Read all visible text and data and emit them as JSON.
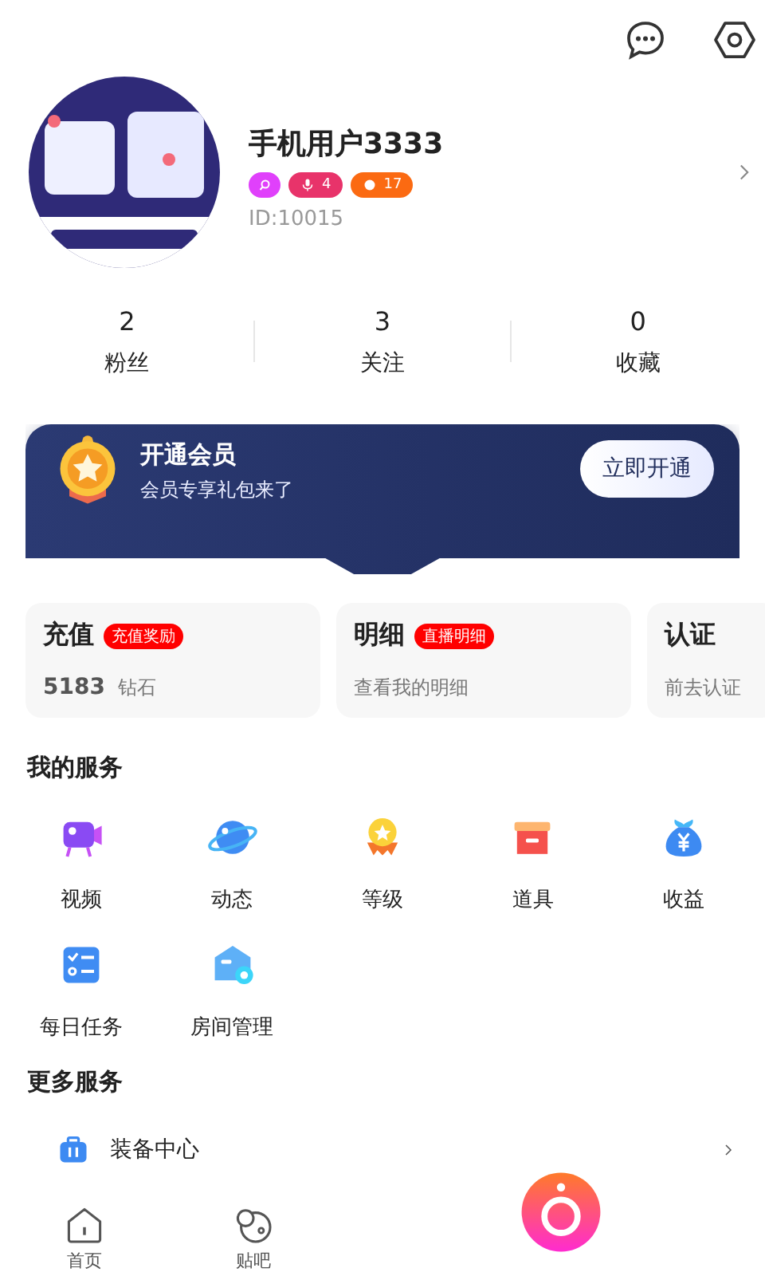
{
  "header": {
    "actions": [
      {
        "kind": "chat"
      },
      {
        "kind": "settings"
      }
    ]
  },
  "profile": {
    "name": "手机用户3333",
    "badges": [
      {
        "kind": "search",
        "color": "#e040fb"
      },
      {
        "kind": "mic",
        "text": "4",
        "color": "#e8336a"
      },
      {
        "kind": "dot",
        "text": "17",
        "color": "#fb6a12"
      }
    ],
    "id": "ID:10015"
  },
  "stats": [
    {
      "value": "2",
      "label": "粉丝"
    },
    {
      "value": "3",
      "label": "关注"
    },
    {
      "value": "0",
      "label": "收藏"
    }
  ],
  "vip_banner": {
    "title": "开通会员",
    "subtitle": "会员专享礼包来了",
    "button": "立即开通"
  },
  "cards": [
    {
      "title": "充值",
      "tag": "充值奖励",
      "amount": "5183",
      "unit": "钻石"
    },
    {
      "title": "明细",
      "tag": "直播明细",
      "subtitle": "查看我的明细"
    },
    {
      "title": "认证",
      "subtitle": "前去认证"
    }
  ],
  "my_services": {
    "title": "我的服务",
    "items": [
      {
        "kind": "video",
        "label": "视频"
      },
      {
        "kind": "planet",
        "label": "动态"
      },
      {
        "kind": "medal",
        "label": "等级"
      },
      {
        "kind": "box",
        "label": "道具"
      },
      {
        "kind": "moneybag",
        "label": "收益"
      },
      {
        "kind": "checklist",
        "label": "每日任务"
      },
      {
        "kind": "house",
        "label": "房间管理"
      }
    ]
  },
  "more_services": {
    "title": "更多服务",
    "items": [
      {
        "kind": "suitcase",
        "label": "装备中心"
      }
    ]
  },
  "bottom_nav": [
    {
      "kind": "home",
      "label": "首页"
    },
    {
      "kind": "bubbles",
      "label": "贴吧"
    },
    {
      "kind": "camera"
    }
  ]
}
